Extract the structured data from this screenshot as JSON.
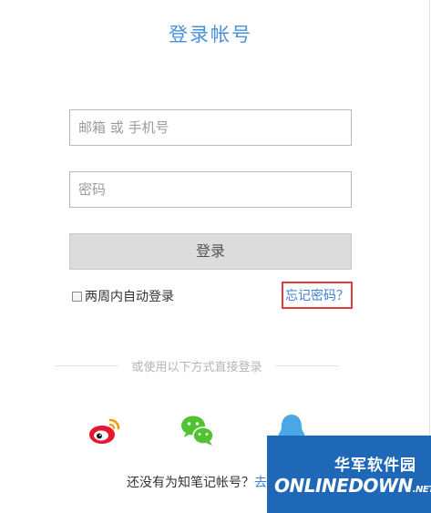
{
  "login": {
    "title": "登录帐号",
    "account_placeholder": "邮箱 或 手机号",
    "password_placeholder": "密码",
    "login_label": "登录",
    "remember_label": "两周内自动登录",
    "forgot_label": "忘记密码？",
    "alt_login_text": "或使用以下方式直接登录",
    "signup_text": "还没有为知笔记帐号？",
    "signup_link": "去"
  },
  "social": [
    "weibo-icon",
    "wechat-icon",
    "qq-icon"
  ],
  "watermark": {
    "chinese": "华军软件园",
    "english": "ONLINEDOWN",
    "suffix": ".NET"
  },
  "colors": {
    "accent": "#4a90d9",
    "link": "#3c82d6",
    "highlight_border": "#e23838",
    "weibo": "#e6162d",
    "wechat": "#51c332",
    "qq": "#4aa7e6",
    "watermark_bg": "#1f67b7"
  }
}
